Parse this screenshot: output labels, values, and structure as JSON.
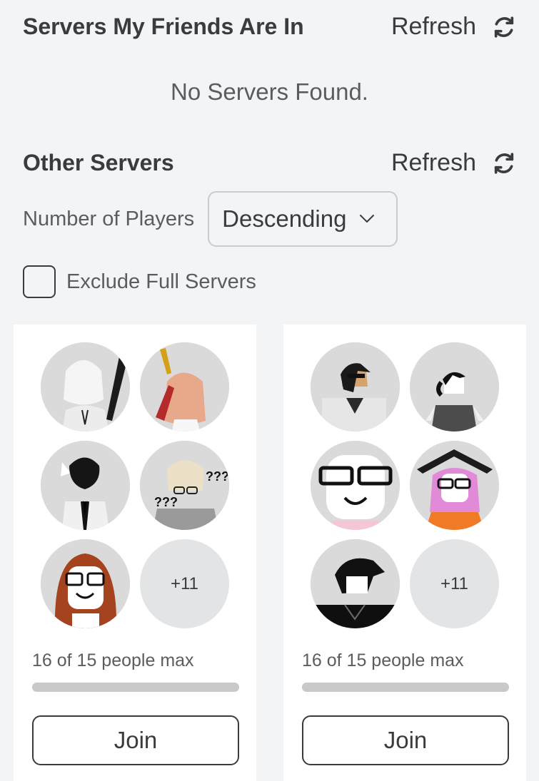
{
  "friends_section": {
    "title": "Servers My Friends Are In",
    "refresh_label": "Refresh",
    "empty_message": "No Servers Found."
  },
  "other_section": {
    "title": "Other Servers",
    "refresh_label": "Refresh",
    "sort_label": "Number of Players",
    "sort_value": "Descending",
    "exclude_full_label": "Exclude Full Servers",
    "exclude_full_checked": false
  },
  "servers": [
    {
      "avatar_icons": [
        "avatar-white-hair-scythe-icon",
        "avatar-peach-hair-sword-icon",
        "avatar-black-hair-wings-icon",
        "avatar-blonde-glasses-question-icon",
        "avatar-red-hair-glasses-icon"
      ],
      "more_count": "+11",
      "capacity_text": "16 of 15 people max",
      "fill_fraction": 1.0,
      "join_label": "Join"
    },
    {
      "avatar_icons": [
        "avatar-black-hair-sunglasses-icon",
        "avatar-black-ponytail-icon",
        "avatar-glasses-face-icon",
        "avatar-pink-hair-book-icon",
        "avatar-black-hair-dark-icon"
      ],
      "more_count": "+11",
      "capacity_text": "16 of 15 people max",
      "fill_fraction": 1.0,
      "join_label": "Join"
    }
  ]
}
